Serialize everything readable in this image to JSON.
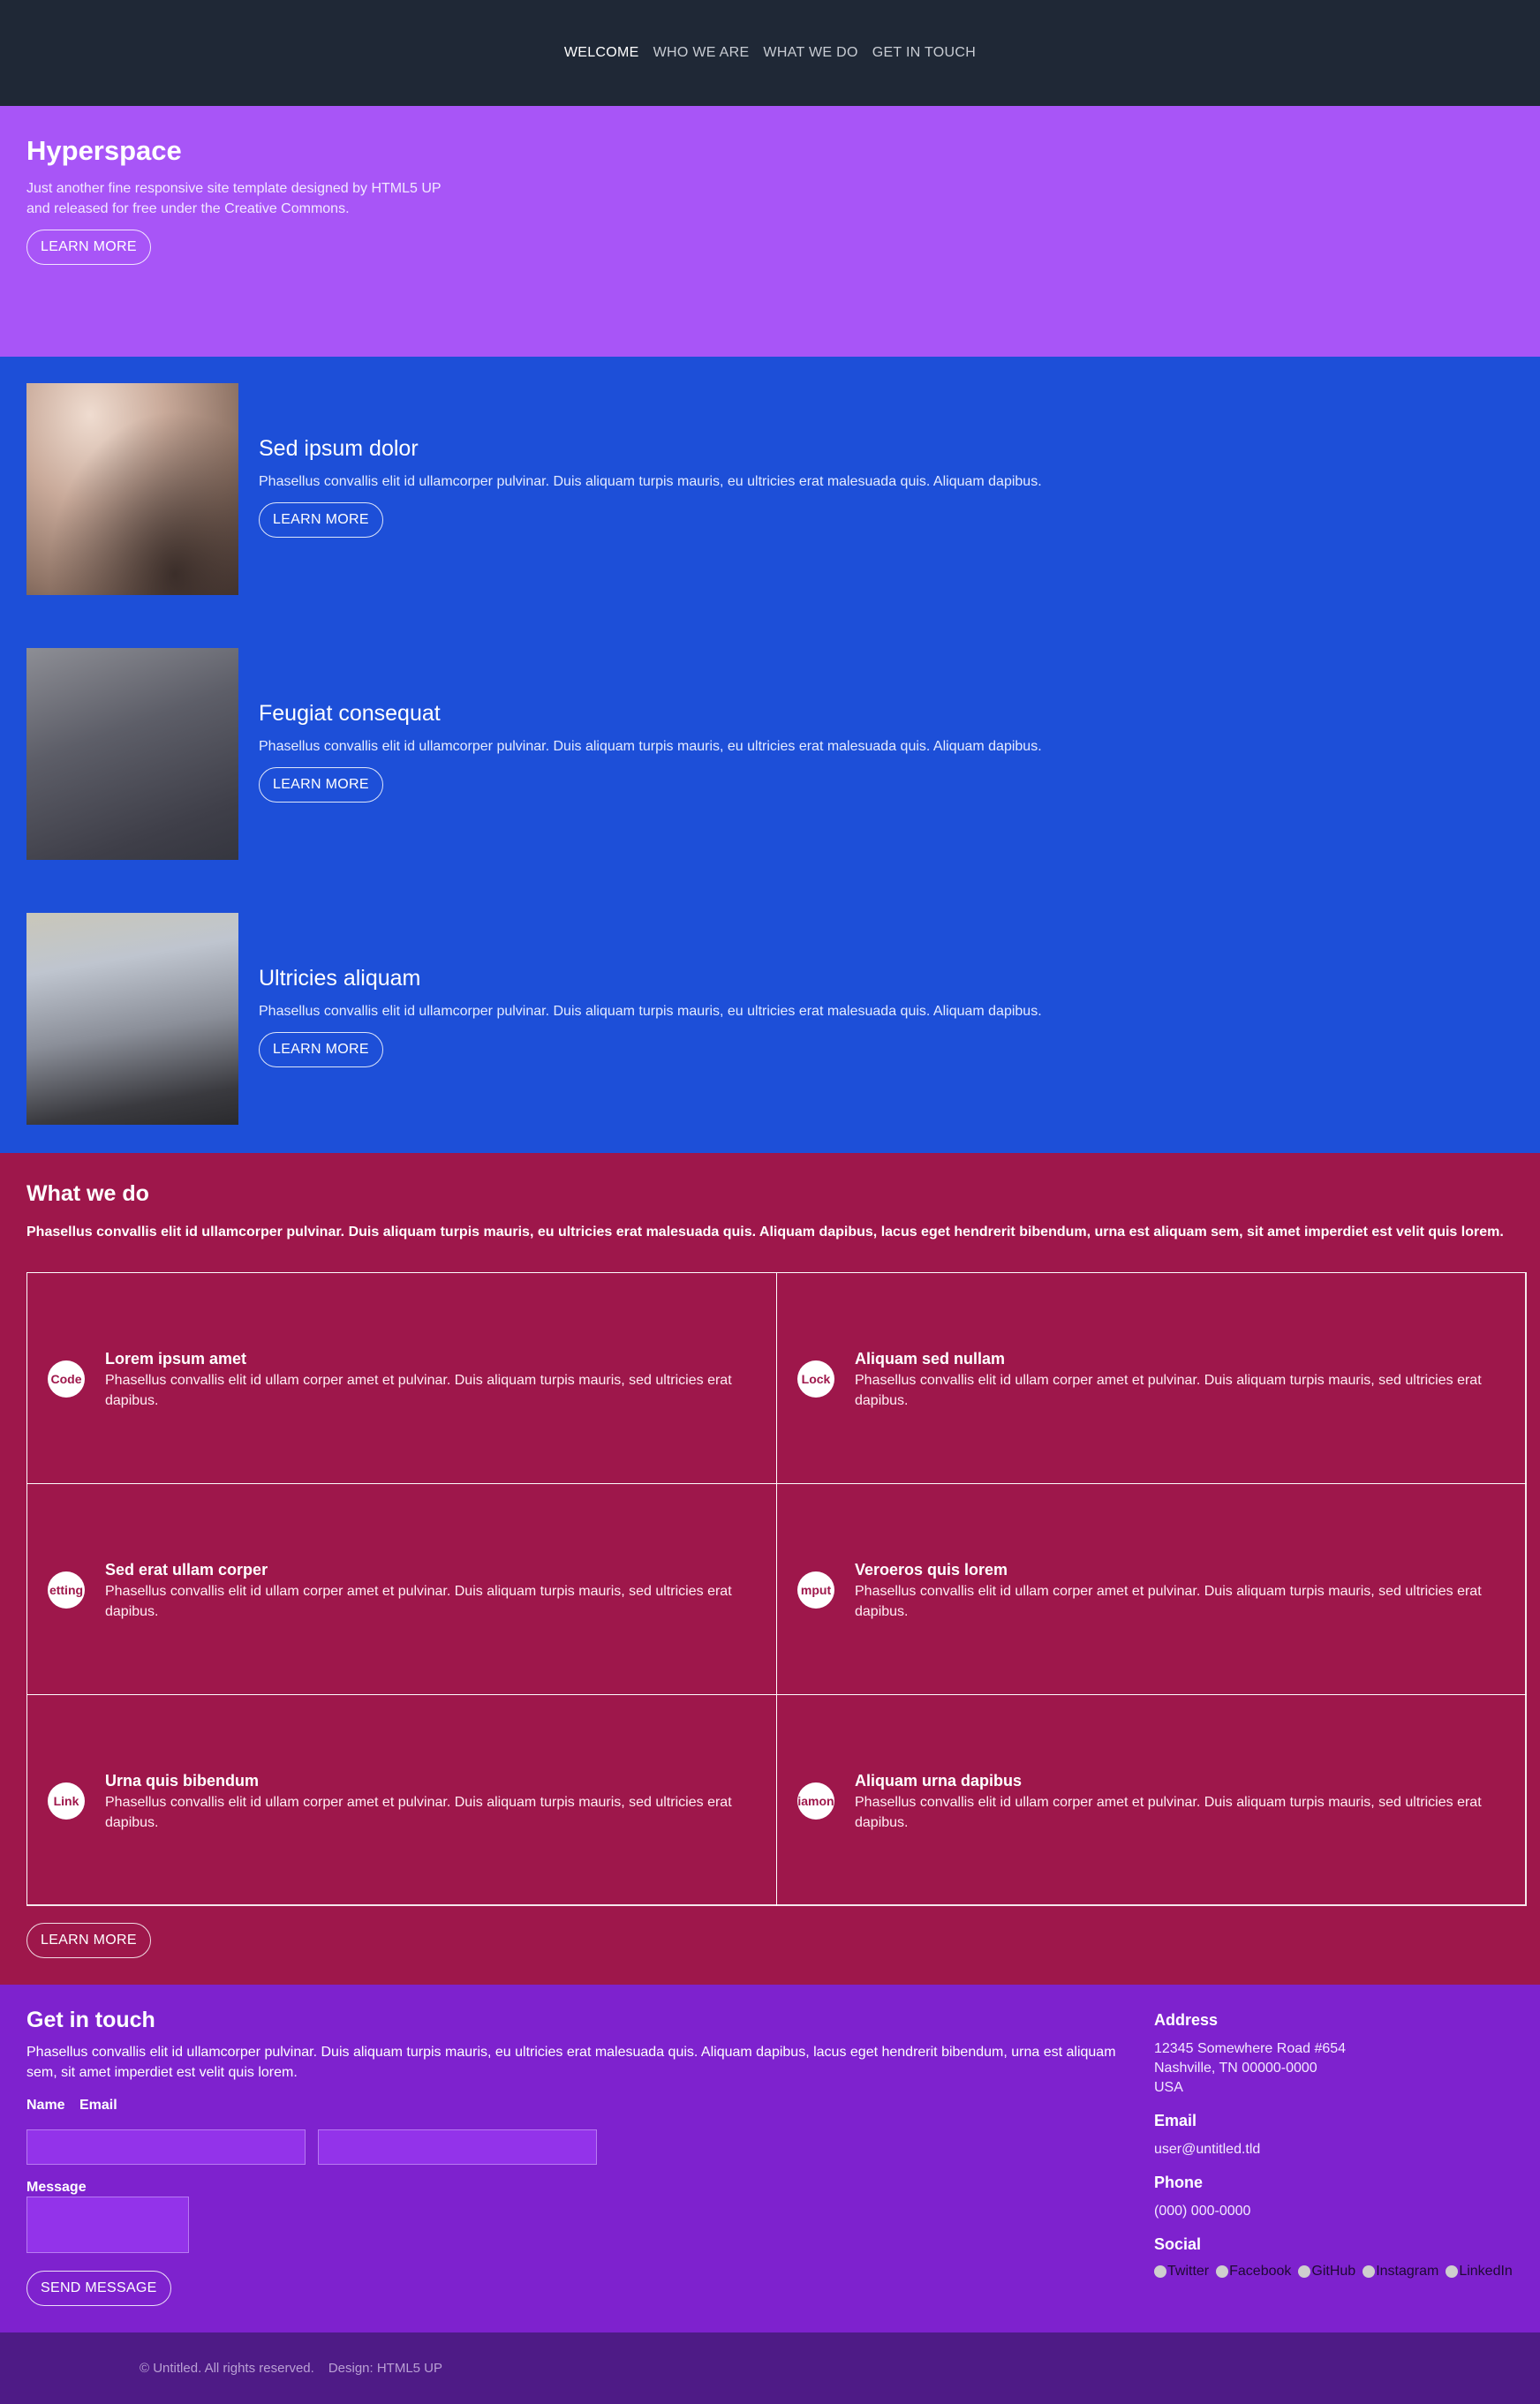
{
  "nav": {
    "items": [
      {
        "label": "WELCOME"
      },
      {
        "label": "WHO WE ARE"
      },
      {
        "label": "WHAT WE DO"
      },
      {
        "label": "GET IN TOUCH"
      }
    ]
  },
  "hero": {
    "title": "Hyperspace",
    "text": "Just another fine responsive site template designed by HTML5 UP and released for free under the Creative Commons.",
    "button": "LEARN MORE"
  },
  "spotlights": [
    {
      "title": "Sed ipsum dolor",
      "text": "Phasellus convallis elit id ullamcorper pulvinar. Duis aliquam turpis mauris, eu ultricies erat malesuada quis. Aliquam dapibus.",
      "button": "LEARN MORE"
    },
    {
      "title": "Feugiat consequat",
      "text": "Phasellus convallis elit id ullamcorper pulvinar. Duis aliquam turpis mauris, eu ultricies erat malesuada quis. Aliquam dapibus.",
      "button": "LEARN MORE"
    },
    {
      "title": "Ultricies aliquam",
      "text": "Phasellus convallis elit id ullamcorper pulvinar. Duis aliquam turpis mauris, eu ultricies erat malesuada quis. Aliquam dapibus.",
      "button": "LEARN MORE"
    }
  ],
  "what": {
    "title": "What we do",
    "lead": "Phasellus convallis elit id ullamcorper pulvinar. Duis aliquam turpis mauris, eu ultricies erat malesuada quis. Aliquam dapibus, lacus eget hendrerit bibendum, urna est aliquam sem, sit amet imperdiet est velit quis lorem.",
    "features": [
      {
        "icon": "Code",
        "title": "Lorem ipsum amet",
        "text": "Phasellus convallis elit id ullam corper amet et pulvinar. Duis aliquam turpis mauris, sed ultricies erat dapibus."
      },
      {
        "icon": "Lock",
        "title": "Aliquam sed nullam",
        "text": "Phasellus convallis elit id ullam corper amet et pulvinar. Duis aliquam turpis mauris, sed ultricies erat dapibus."
      },
      {
        "icon": "etting",
        "title": "Sed erat ullam corper",
        "text": "Phasellus convallis elit id ullam corper amet et pulvinar. Duis aliquam turpis mauris, sed ultricies erat dapibus."
      },
      {
        "icon": "mput",
        "title": "Veroeros quis lorem",
        "text": "Phasellus convallis elit id ullam corper amet et pulvinar. Duis aliquam turpis mauris, sed ultricies erat dapibus."
      },
      {
        "icon": "Link",
        "title": "Urna quis bibendum",
        "text": "Phasellus convallis elit id ullam corper amet et pulvinar. Duis aliquam turpis mauris, sed ultricies erat dapibus."
      },
      {
        "icon": "iamon",
        "title": "Aliquam urna dapibus",
        "text": "Phasellus convallis elit id ullam corper amet et pulvinar. Duis aliquam turpis mauris, sed ultricies erat dapibus."
      }
    ],
    "button": "LEARN MORE"
  },
  "contact": {
    "title": "Get in touch",
    "intro": "Phasellus convallis elit id ullamcorper pulvinar. Duis aliquam turpis mauris, eu ultricies erat malesuada quis. Aliquam dapibus, lacus eget hendrerit bibendum, urna est aliquam sem, sit amet imperdiet est velit quis lorem.",
    "name_label": "Name",
    "email_label": "Email",
    "message_label": "Message",
    "name_value": "",
    "email_value": "",
    "message_value": "",
    "submit": "SEND MESSAGE",
    "address_heading": "Address",
    "address_lines": [
      "12345 Somewhere Road #654",
      "Nashville, TN 00000-0000",
      "USA"
    ],
    "email_heading": "Email",
    "email": "user@untitled.tld",
    "phone_heading": "Phone",
    "phone": "(000) 000-0000",
    "social_heading": "Social",
    "social": [
      "Twitter",
      "Facebook",
      "GitHub",
      "Instagram",
      "LinkedIn"
    ]
  },
  "footer": {
    "copyright": "© Untitled. All rights reserved.",
    "design": "Design: HTML5 UP"
  },
  "colors": {
    "nav_bg": "#1f2836",
    "hero_bg": "#a855f7",
    "spotlights_bg": "#1d4fd8",
    "what_bg": "#9e174b",
    "contact_bg": "#7e22ce",
    "footer_bg": "#4e1b86"
  }
}
